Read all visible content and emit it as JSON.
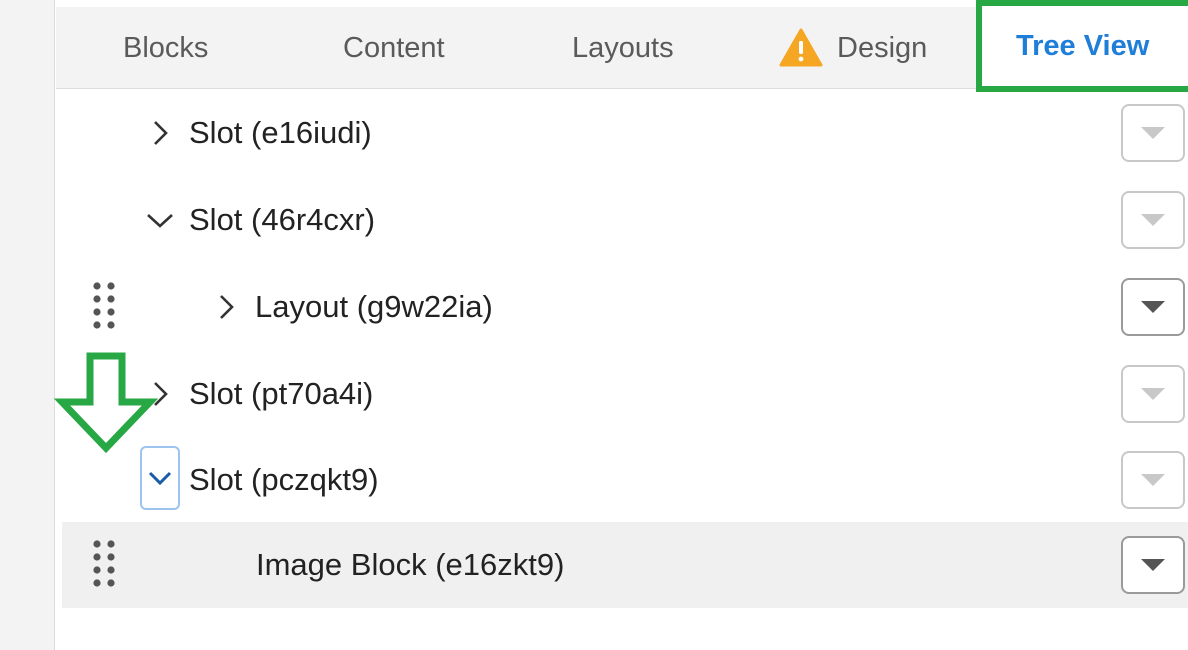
{
  "tabs": [
    {
      "label": "Blocks"
    },
    {
      "label": "Content"
    },
    {
      "label": "Layouts"
    },
    {
      "label": "Design",
      "icon": "warning-icon",
      "icon_color": "#f5a623"
    },
    {
      "label": "Tree View",
      "active": true,
      "color": "#1f7ed8"
    }
  ],
  "highlight_color": "#27a844",
  "tree": [
    {
      "label": "Slot (e16iudi)",
      "expander": "chevron-right-icon",
      "menu_active": false
    },
    {
      "label": "Slot (46r4cxr)",
      "expander": "chevron-down-icon",
      "menu_active": false
    },
    {
      "label": "Layout (g9w22ia)",
      "expander": "chevron-right-icon",
      "draggable": true,
      "menu_active": true
    },
    {
      "label": "Slot (pt70a4i)",
      "expander": "chevron-right-icon",
      "menu_active": false
    },
    {
      "label": "Slot (pczqkt9)",
      "expander": "chevron-down-icon",
      "focused": true,
      "menu_active": false
    },
    {
      "label": "Image Block (e16zkt9)",
      "draggable": true,
      "selected": true,
      "menu_active": true
    }
  ]
}
